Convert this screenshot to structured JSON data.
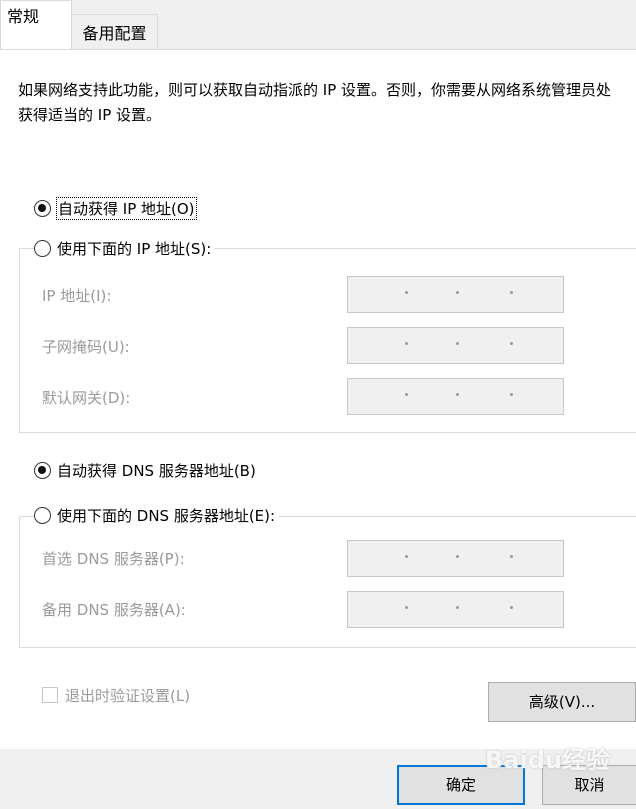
{
  "tabs": [
    {
      "label": "常规"
    },
    {
      "label": "备用配置"
    }
  ],
  "description": "如果网络支持此功能，则可以获取自动指派的 IP 设置。否则，你需要从网络系统管理员处获得适当的 IP 设置。",
  "ip_section": {
    "auto_option": {
      "label": "自动获得 IP 地址(O)",
      "checked": true
    },
    "manual_option": {
      "label": "使用下面的 IP 地址(S):",
      "checked": false
    },
    "fields": [
      {
        "label": "IP 地址(I):",
        "value": ""
      },
      {
        "label": "子网掩码(U):",
        "value": ""
      },
      {
        "label": "默认网关(D):",
        "value": ""
      }
    ]
  },
  "dns_section": {
    "auto_option": {
      "label": "自动获得 DNS 服务器地址(B)",
      "checked": true
    },
    "manual_option": {
      "label": "使用下面的 DNS 服务器地址(E):",
      "checked": false
    },
    "fields": [
      {
        "label": "首选 DNS 服务器(P):",
        "value": ""
      },
      {
        "label": "备用 DNS 服务器(A):",
        "value": ""
      }
    ]
  },
  "validate_checkbox": {
    "label": "退出时验证设置(L)",
    "checked": false
  },
  "buttons": {
    "advanced": "高级(V)...",
    "ok": "确定",
    "cancel": "取消"
  },
  "watermark": "Baidu经验",
  "colors": {
    "focus_border": "#0078d7",
    "disabled_text": "#9a9a9a",
    "panel_bg": "#ffffff",
    "dialog_bg": "#f0f0f0"
  }
}
